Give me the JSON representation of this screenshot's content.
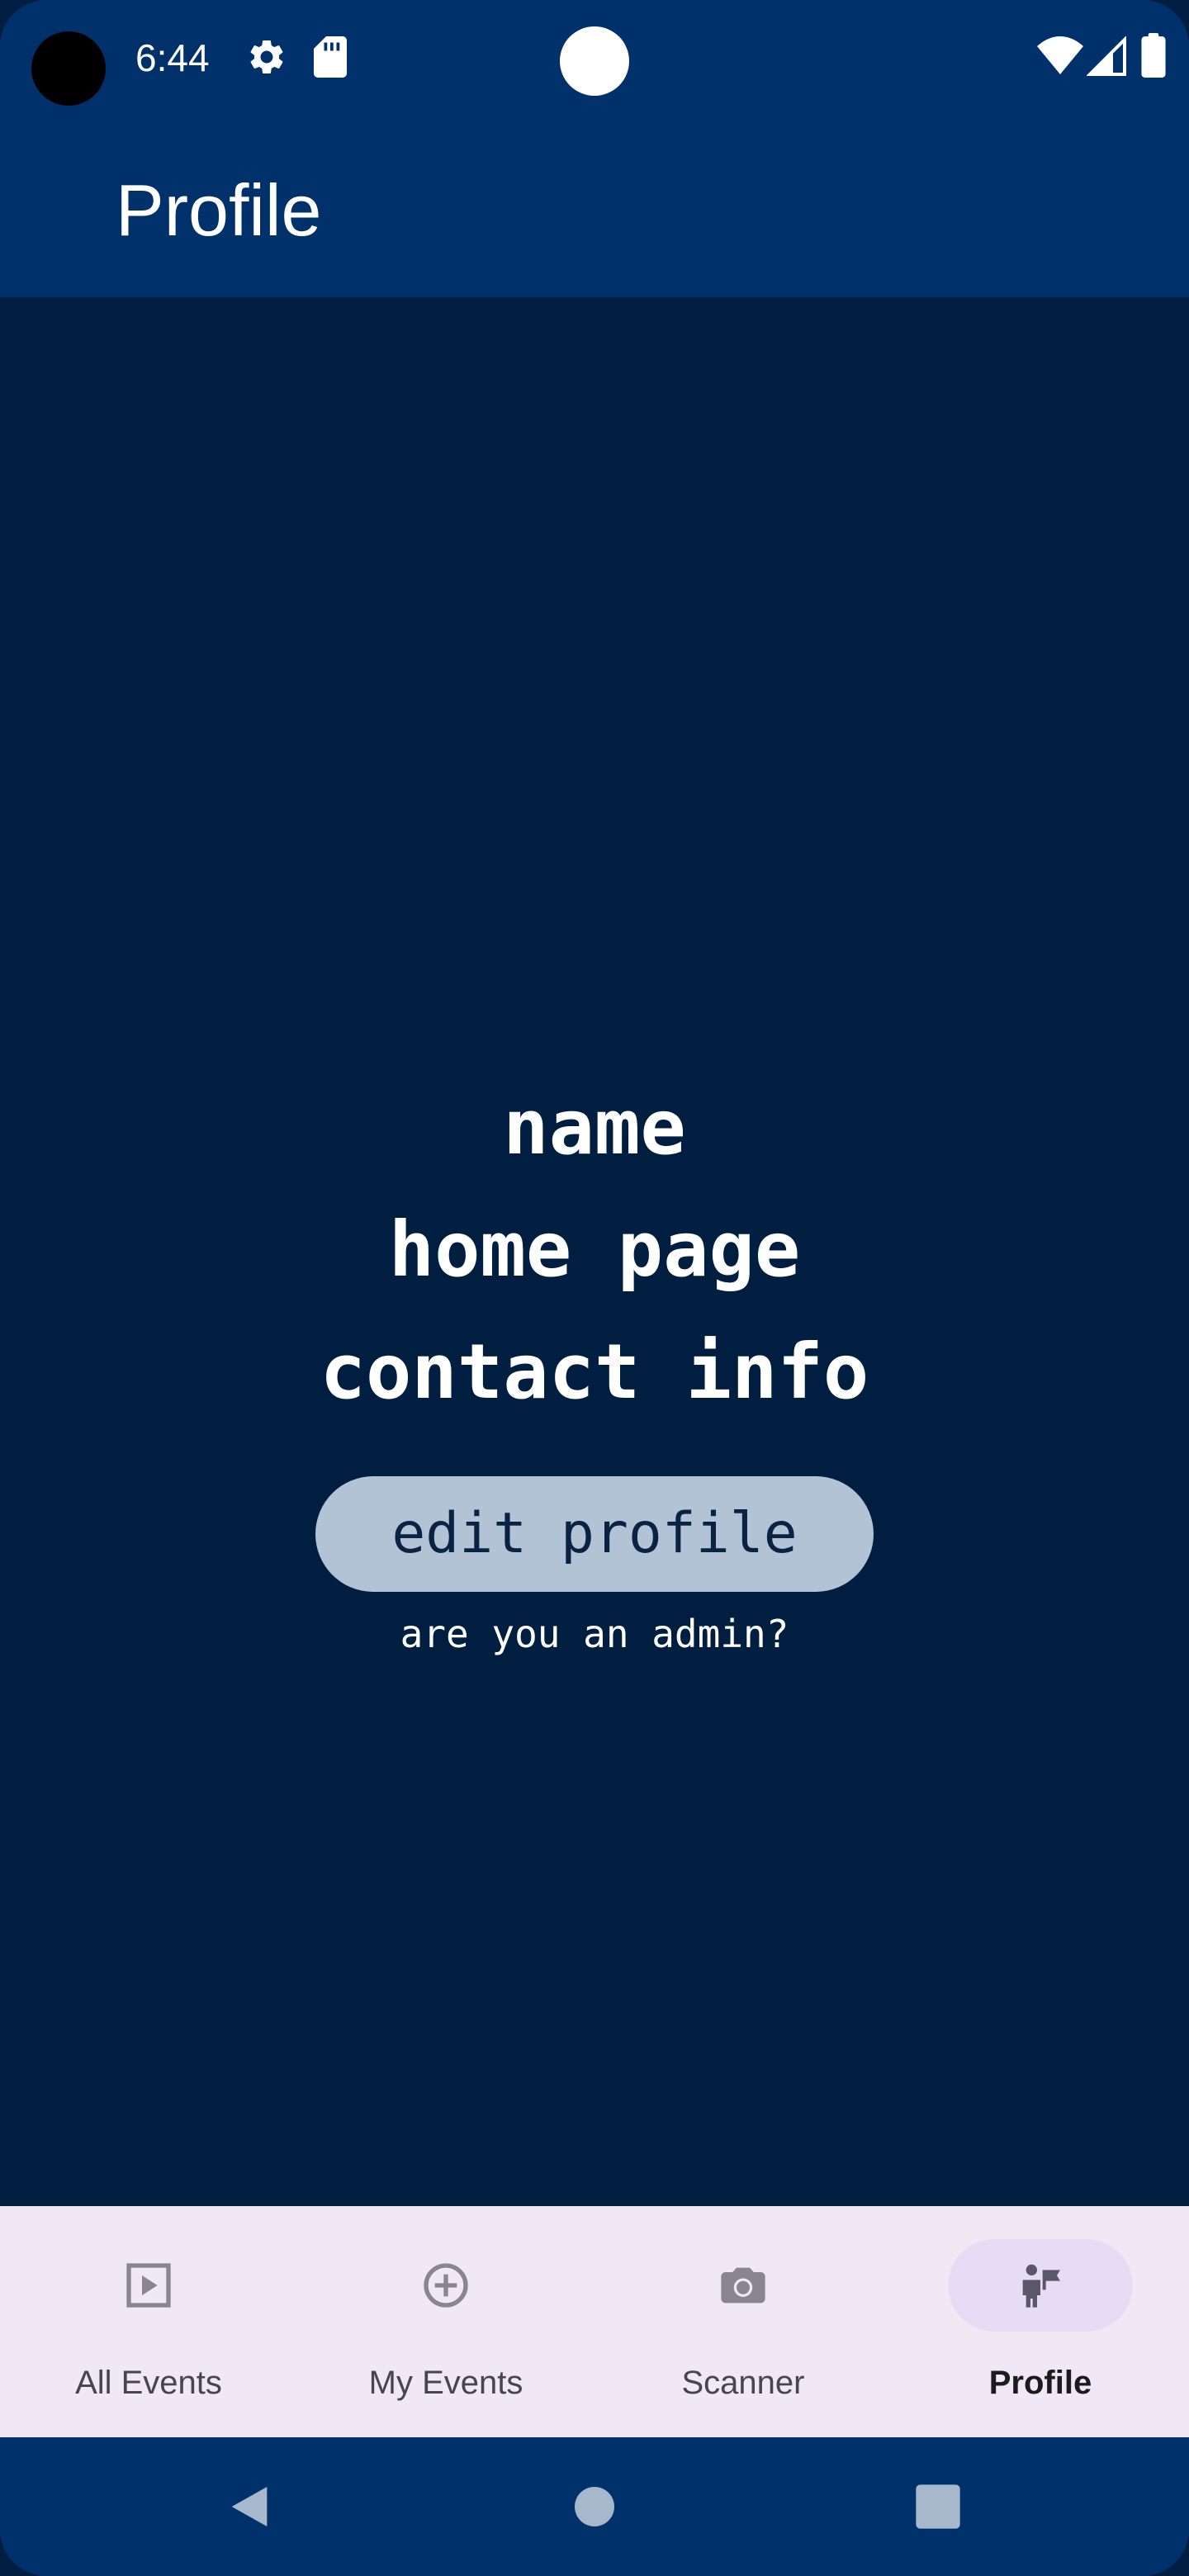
{
  "status_bar": {
    "time": "6:44",
    "icons": [
      "camera-cutout",
      "gear-icon",
      "sd-card-icon",
      "center-camera",
      "wifi-icon",
      "cell-signal-icon",
      "battery-icon"
    ]
  },
  "app_bar": {
    "title": "Profile"
  },
  "profile": {
    "name": "name",
    "home_page": "home page",
    "contact_info": "contact info",
    "edit_button_label": "edit profile",
    "admin_link": "are you an admin?"
  },
  "bottom_nav": {
    "items": [
      {
        "label": "All Events",
        "icon": "play-square-icon",
        "active": false
      },
      {
        "label": "My Events",
        "icon": "add-circle-icon",
        "active": false
      },
      {
        "label": "Scanner",
        "icon": "camera-icon",
        "active": false
      },
      {
        "label": "Profile",
        "icon": "person-flag-icon",
        "active": true
      }
    ]
  },
  "system_nav": {
    "buttons": [
      "back-icon",
      "home-icon",
      "recents-icon"
    ]
  },
  "colors": {
    "top_bar": "#00316a",
    "background": "#001f40",
    "button_bg": "#b3c3d6",
    "nav_bg": "#f1e8f6",
    "nav_active_pill": "#e6dcf4"
  }
}
